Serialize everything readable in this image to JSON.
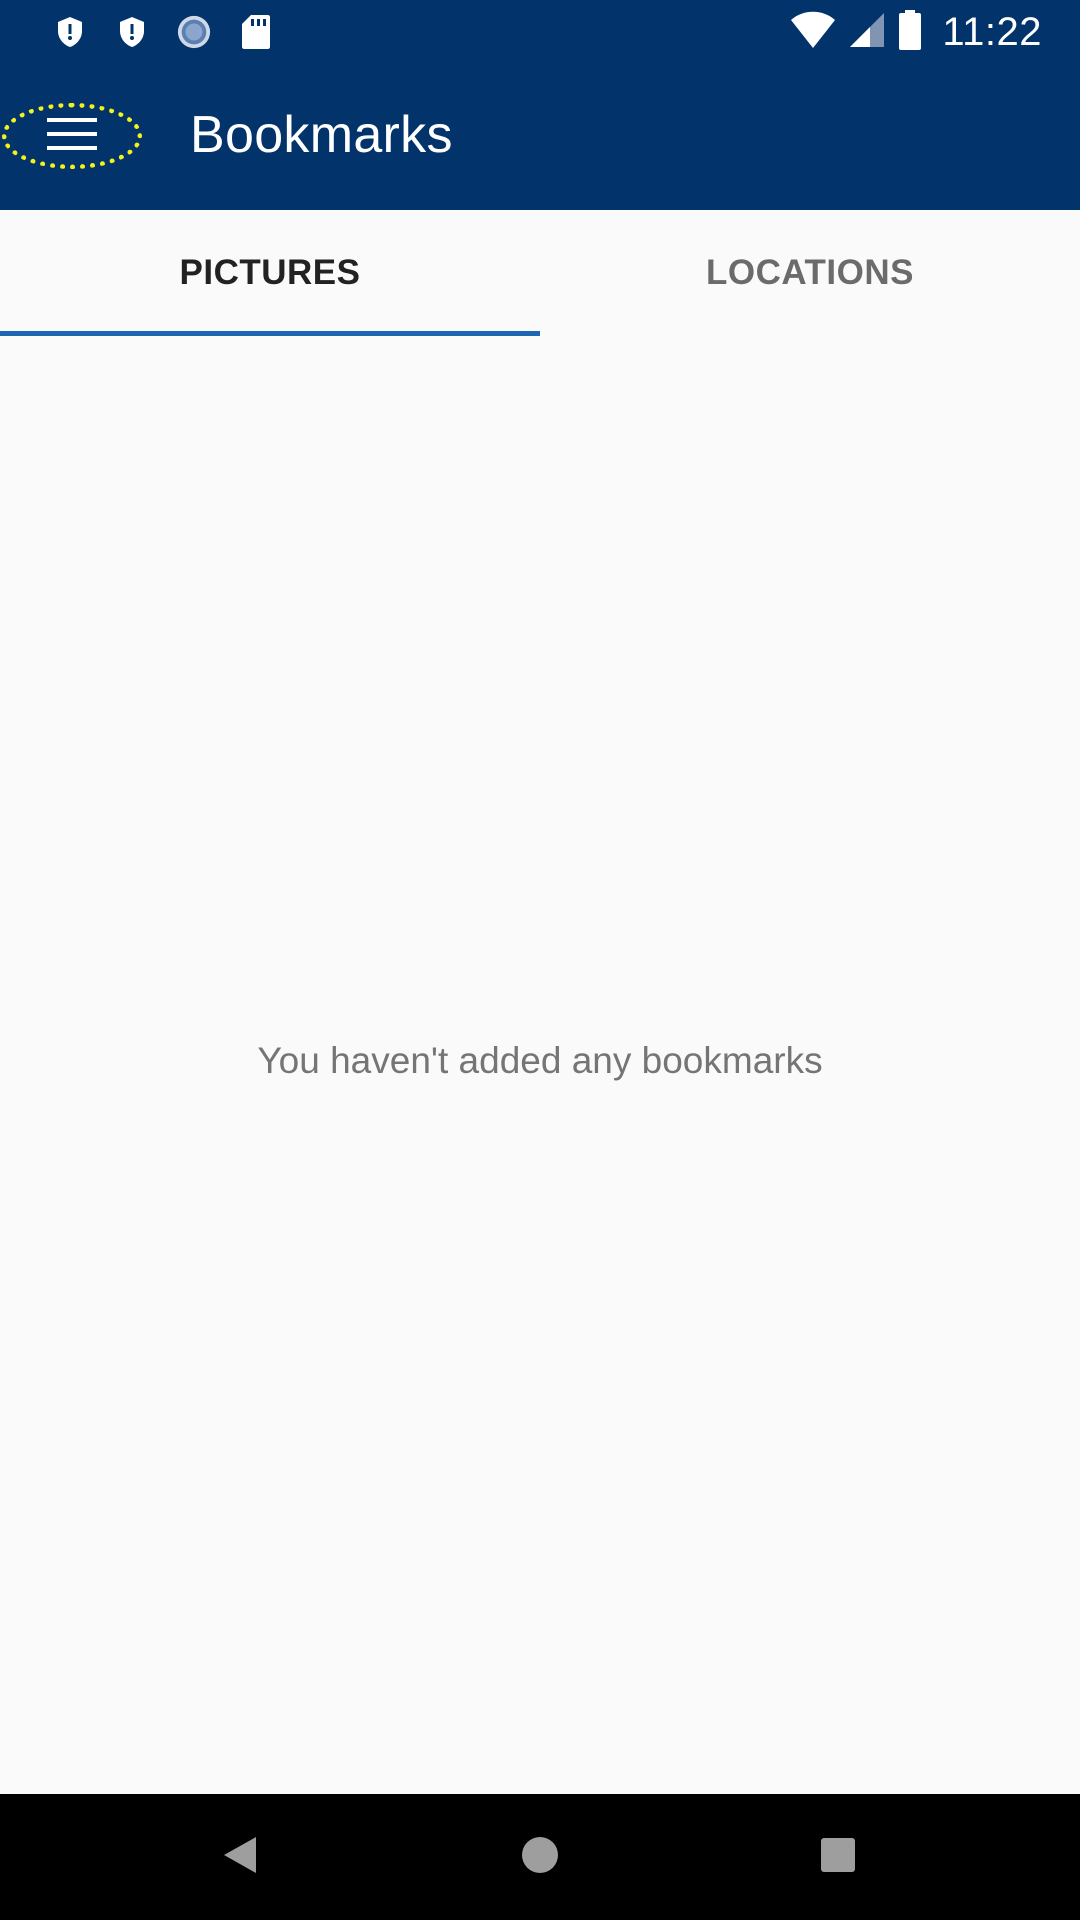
{
  "status_bar": {
    "time": "11:22",
    "left_icons": [
      "shield-alert-icon",
      "shield-alert-icon",
      "sync-icon",
      "sd-card-icon"
    ],
    "right_icons": [
      "wifi-icon",
      "signal-icon",
      "battery-icon"
    ]
  },
  "app_bar": {
    "title": "Bookmarks",
    "menu_icon": "hamburger-menu-icon"
  },
  "tabs": [
    {
      "label": "PICTURES",
      "active": true
    },
    {
      "label": "LOCATIONS",
      "active": false
    }
  ],
  "empty_state": {
    "message": "You haven't added any bookmarks"
  },
  "nav_bar": {
    "buttons": [
      "back-icon",
      "home-icon",
      "recents-icon"
    ]
  },
  "colors": {
    "primary": "#02346b",
    "tab_indicator": "#1e66b3",
    "highlight": "#f5f21a",
    "background": "#fafafa"
  }
}
